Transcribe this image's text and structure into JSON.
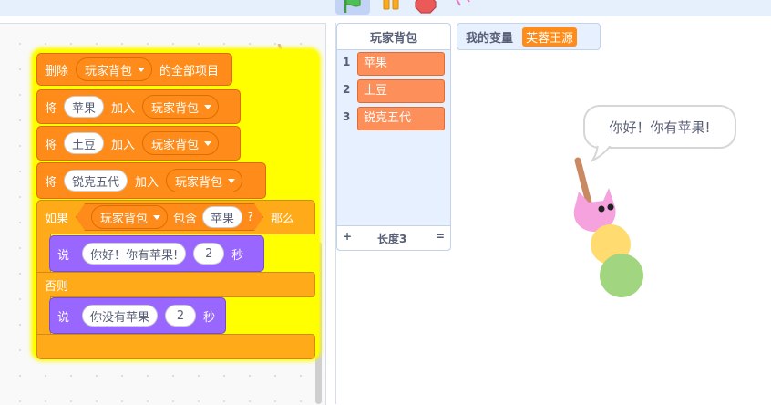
{
  "toolbar": {
    "green_flag": "green-flag-icon",
    "pause": "pause-icon",
    "stop": "stop-icon"
  },
  "blocks": {
    "delete_all": {
      "prefix": "删除",
      "list": "玩家背包",
      "suffix": "的全部项目"
    },
    "add_items": [
      {
        "prefix": "将",
        "item": "苹果",
        "mid": "加入",
        "list": "玩家背包"
      },
      {
        "prefix": "将",
        "item": "土豆",
        "mid": "加入",
        "list": "玩家背包"
      },
      {
        "prefix": "将",
        "item": "锐克五代",
        "mid": "加入",
        "list": "玩家背包"
      }
    ],
    "if_else": {
      "if_label": "如果",
      "list": "玩家背包",
      "contains": "包含",
      "item": "苹果",
      "question": "?",
      "then": "那么",
      "else_label": "否则"
    },
    "say_then": {
      "say": "说",
      "message": "你好！你有苹果!",
      "secs": "2",
      "unit": "秒"
    },
    "say_else": {
      "say": "说",
      "message": "你没有苹果",
      "secs": "2",
      "unit": "秒"
    }
  },
  "list_monitor": {
    "title": "玩家背包",
    "items": [
      {
        "index": "1",
        "value": "苹果"
      },
      {
        "index": "2",
        "value": "土豆"
      },
      {
        "index": "3",
        "value": "锐克五代"
      }
    ],
    "add": "+",
    "length": "长度3",
    "resize": "="
  },
  "variable_monitor": {
    "label": "我的变量",
    "value": "芙蓉王源"
  },
  "stage": {
    "speech": "你好！你有苹果!"
  },
  "colors": {
    "events_orange": "#ff8c1a",
    "control": "#ffab19",
    "looks": "#9966ff",
    "glow": "#ffff00",
    "list_item": "#fc8f5a"
  }
}
